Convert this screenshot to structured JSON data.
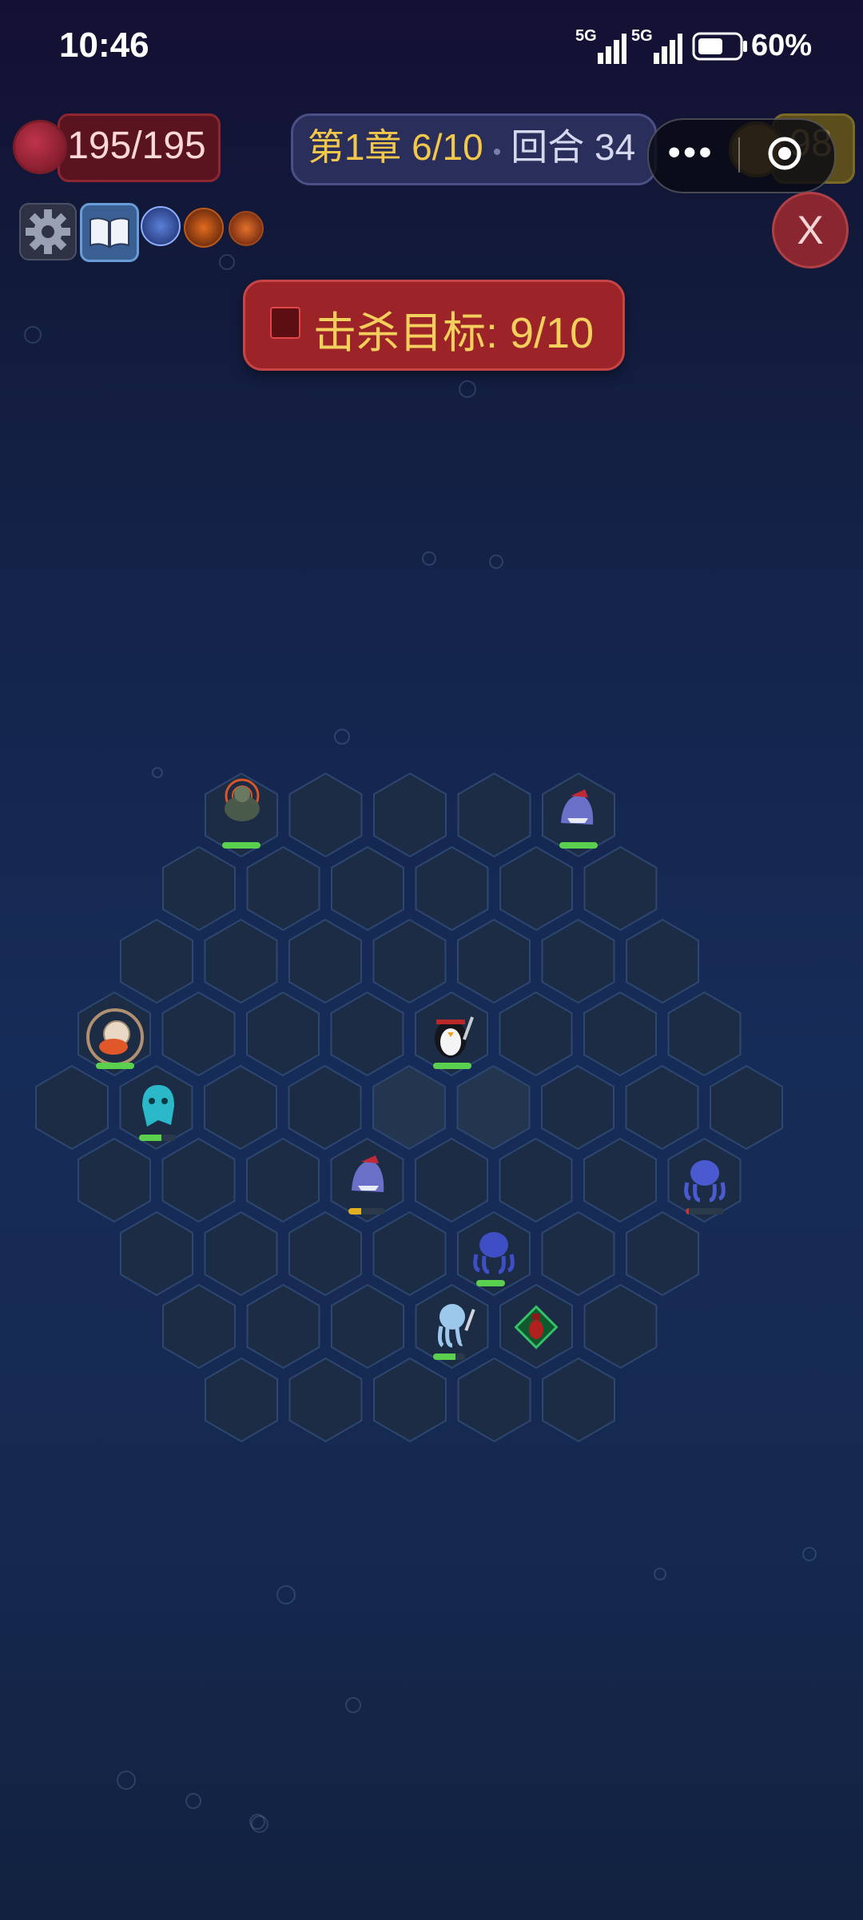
{
  "status_bar": {
    "time": "10:46",
    "signal1": "5G",
    "signal2": "5G",
    "battery": "60%"
  },
  "hud": {
    "hp": "195/195",
    "chapter": "第1章 6/10",
    "round": "回合 34",
    "gold": "98",
    "close_label": "X",
    "capsule_dots": "•••"
  },
  "objective": {
    "text": "击杀目标: 9/10"
  },
  "colors": {
    "kill_banner": "#9c2428",
    "objective_text": "#f3cf5c",
    "hp_green": "#5bd04f",
    "hp_yellow": "#e0b020",
    "hp_red": "#c23838"
  },
  "board": {
    "units": [
      {
        "name": "turtle-enemy",
        "icon": "turtle-icon",
        "hp_fraction": 1.0,
        "targeted": true
      },
      {
        "name": "shark-enemy-top",
        "icon": "shark-icon",
        "hp_fraction": 1.0
      },
      {
        "name": "hermit-crab-enemy",
        "icon": "crab-icon",
        "hp_fraction": 1.0,
        "targeted": true
      },
      {
        "name": "penguin-player",
        "icon": "penguin-icon",
        "hp_fraction": 1.0
      },
      {
        "name": "jelly-ghost-enemy",
        "icon": "ghost-icon",
        "hp_fraction": 0.6
      },
      {
        "name": "shark-enemy-mid",
        "icon": "shark-icon",
        "hp_fraction": 0.35
      },
      {
        "name": "octopus-enemy-right",
        "icon": "octopus-icon",
        "hp_fraction": 0.08
      },
      {
        "name": "octopus-enemy-bottom",
        "icon": "octopus-icon",
        "hp_fraction": 1.0
      },
      {
        "name": "squid-ally",
        "icon": "squid-icon",
        "hp_fraction": 0.7
      },
      {
        "name": "health-potion-pickup",
        "icon": "potion-icon"
      }
    ]
  }
}
